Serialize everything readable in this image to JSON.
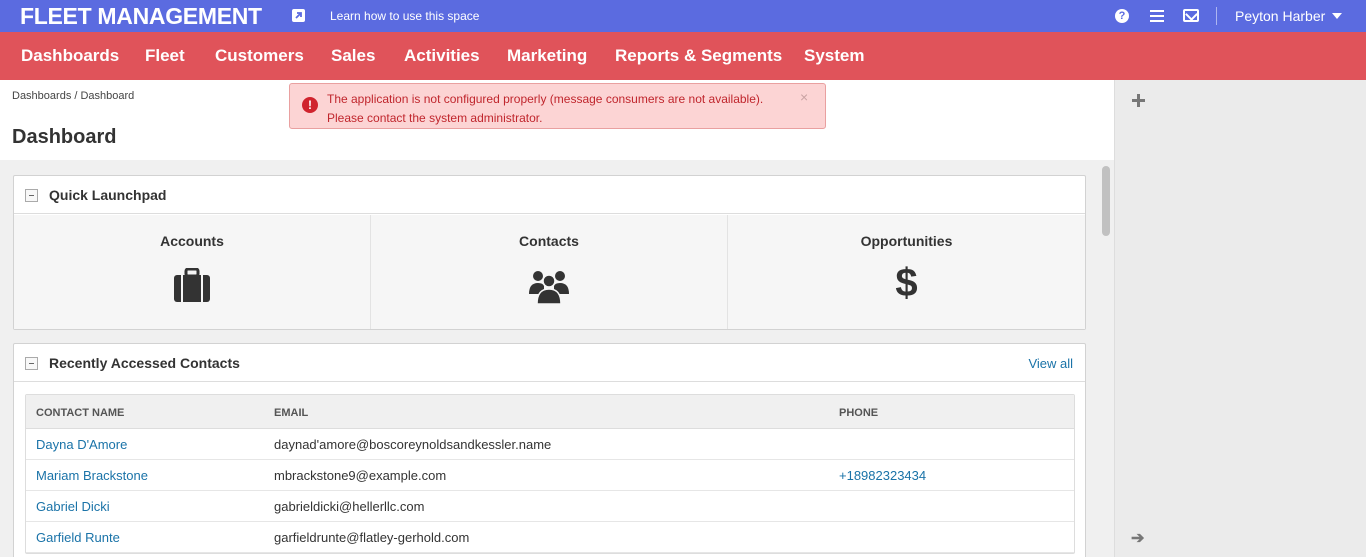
{
  "topbar": {
    "brand": "FLEET MANAGEMENT",
    "learn_link": "Learn how to use this space",
    "user_name": "Peyton Harber"
  },
  "mainnav": {
    "items": [
      "Dashboards",
      "Fleet",
      "Customers",
      "Sales",
      "Activities",
      "Marketing",
      "Reports & Segments",
      "System"
    ]
  },
  "breadcrumb": "Dashboards / Dashboard",
  "page_title": "Dashboard",
  "alert": {
    "message": "The application is not configured properly (message consumers are not available). Please contact the system administrator.",
    "close": "×"
  },
  "quick_launchpad": {
    "title": "Quick Launchpad",
    "items": [
      {
        "label": "Accounts",
        "icon": "briefcase-icon"
      },
      {
        "label": "Contacts",
        "icon": "users-icon"
      },
      {
        "label": "Opportunities",
        "icon": "dollar-icon"
      }
    ]
  },
  "recent_contacts": {
    "title": "Recently Accessed Contacts",
    "view_all": "View all",
    "columns": [
      "CONTACT NAME",
      "EMAIL",
      "PHONE"
    ],
    "rows": [
      {
        "name": "Dayna D'Amore",
        "email": "daynad'amore@boscoreynoldsandkessler.name",
        "phone": ""
      },
      {
        "name": "Mariam Brackstone",
        "email": "mbrackstone9@example.com",
        "phone": "+18982323434"
      },
      {
        "name": "Gabriel Dicki",
        "email": "gabrieldicki@hellerllc.com",
        "phone": ""
      },
      {
        "name": "Garfield Runte",
        "email": "garfieldrunte@flatley-gerhold.com",
        "phone": ""
      }
    ]
  },
  "colors": {
    "topbar": "#5b6be0",
    "mainnav": "#e0535a",
    "link": "#1a73a8",
    "alert_bg": "#fcd4d4",
    "alert_text": "#c0262d"
  }
}
